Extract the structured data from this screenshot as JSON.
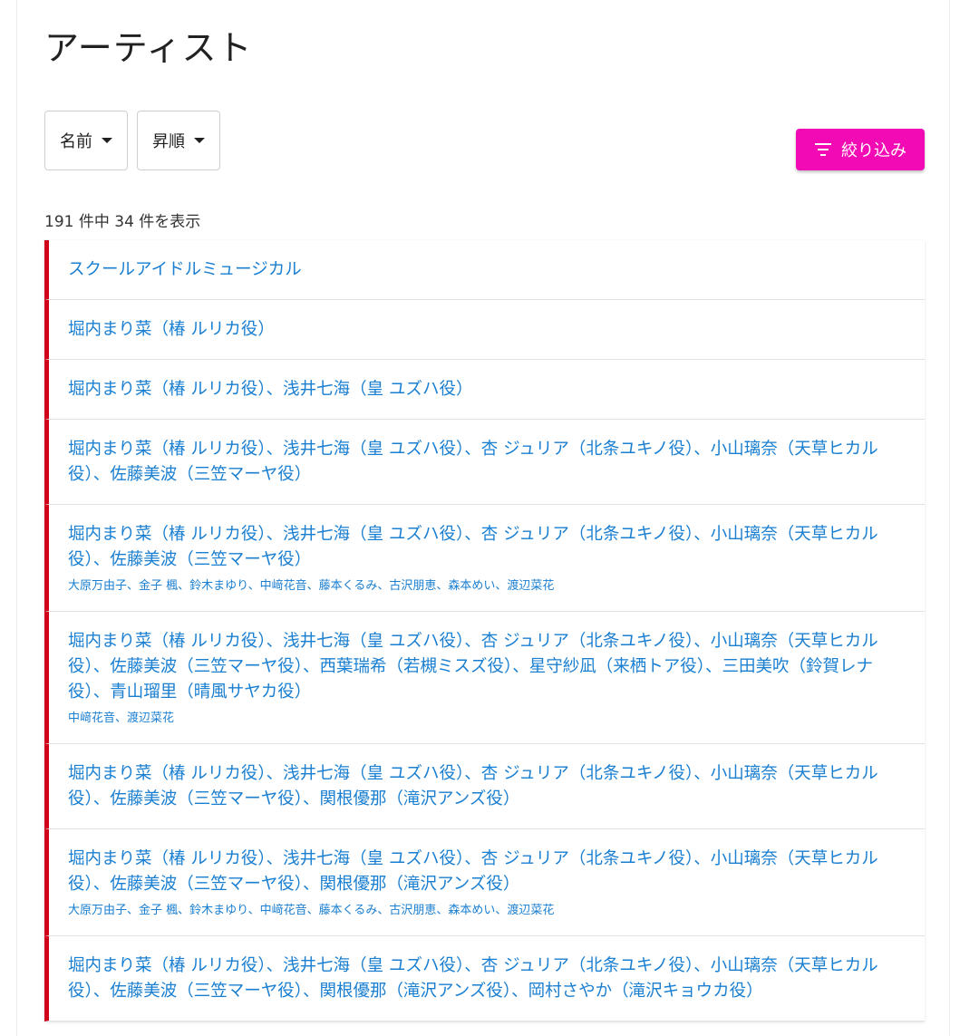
{
  "header": {
    "title": "アーティスト"
  },
  "controls": {
    "sort_field_label": "名前",
    "sort_order_label": "昇順",
    "filter_label": "絞り込み"
  },
  "results": {
    "count_text": "191 件中 34 件を表示"
  },
  "colors": {
    "accent": "#f20bb5",
    "link": "#1a7fd1",
    "item_bar": "#d0021b"
  },
  "items": [
    {
      "title": "スクールアイドルミュージカル",
      "sub": ""
    },
    {
      "title": "堀内まり菜（椿 ルリカ役）",
      "sub": ""
    },
    {
      "title": "堀内まり菜（椿 ルリカ役）、浅井七海（皇 ユズハ役）",
      "sub": ""
    },
    {
      "title": "堀内まり菜（椿 ルリカ役）、浅井七海（皇 ユズハ役）、杏 ジュリア（北条ユキノ役）、小山璃奈（天草ヒカル役）、佐藤美波（三笠マーヤ役）",
      "sub": ""
    },
    {
      "title": "堀内まり菜（椿 ルリカ役）、浅井七海（皇 ユズハ役）、杏 ジュリア（北条ユキノ役）、小山璃奈（天草ヒカル役）、佐藤美波（三笠マーヤ役）",
      "sub": "大原万由子、金子 楓、鈴木まゆり、中﨑花音、藤本くるみ、古沢朋恵、森本めい、渡辺菜花"
    },
    {
      "title": "堀内まり菜（椿 ルリカ役）、浅井七海（皇 ユズハ役）、杏 ジュリア（北条ユキノ役）、小山璃奈（天草ヒカル役）、佐藤美波（三笠マーヤ役）、西葉瑞希（若槻ミスズ役）、星守紗凪（来栖トア役）、三田美吹（鈴賀レナ役）、青山瑠里（晴風サヤカ役）",
      "sub": "中﨑花音、渡辺菜花"
    },
    {
      "title": "堀内まり菜（椿 ルリカ役）、浅井七海（皇 ユズハ役）、杏 ジュリア（北条ユキノ役）、小山璃奈（天草ヒカル役）、佐藤美波（三笠マーヤ役）、関根優那（滝沢アンズ役）",
      "sub": ""
    },
    {
      "title": "堀内まり菜（椿 ルリカ役）、浅井七海（皇 ユズハ役）、杏 ジュリア（北条ユキノ役）、小山璃奈（天草ヒカル役）、佐藤美波（三笠マーヤ役）、関根優那（滝沢アンズ役）",
      "sub": "大原万由子、金子 楓、鈴木まゆり、中﨑花音、藤本くるみ、古沢朋恵、森本めい、渡辺菜花"
    },
    {
      "title": "堀内まり菜（椿 ルリカ役）、浅井七海（皇 ユズハ役）、杏 ジュリア（北条ユキノ役）、小山璃奈（天草ヒカル役）、佐藤美波（三笠マーヤ役）、関根優那（滝沢アンズ役）、岡村さやか（滝沢キョウカ役）",
      "sub": ""
    }
  ]
}
